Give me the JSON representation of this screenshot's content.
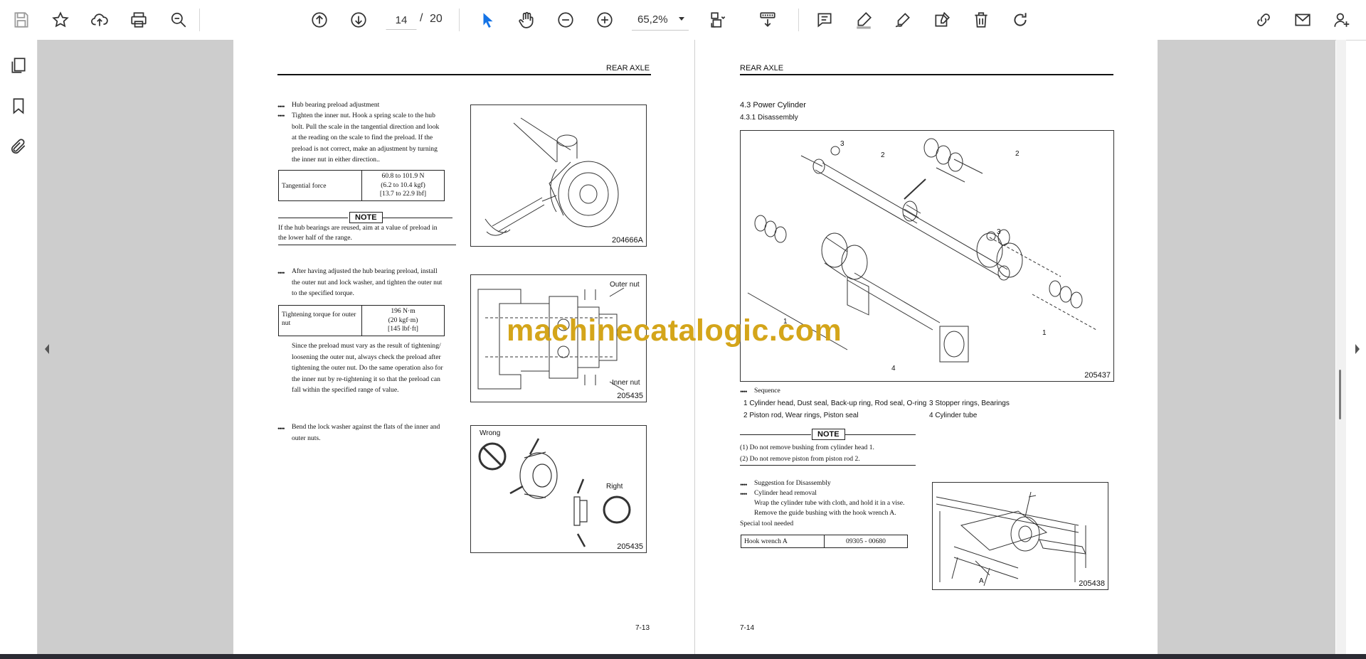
{
  "toolbar": {
    "page_current": "14",
    "page_separator": "/",
    "page_total": "20",
    "zoom_value": "65,2%"
  },
  "left_page": {
    "header": "REAR AXLE",
    "bullet_marker": "••••",
    "step1_title": "Hub bearing preload adjustment",
    "step1_lines": [
      "Tighten the inner nut. Hook a spring scale to the hub",
      "bolt. Pull the scale in the tangential direction and look",
      "at the reading on the scale to find the preload. If the",
      "preload is not correct, make an adjustment by turning",
      "the inner nut in either direction.."
    ],
    "spec1_label": "Tangential force",
    "spec1_values": [
      "60.8 to 101.9 N",
      "(6.2 to 10.4 kgf)",
      "[13.7 to 22.9 lbf]"
    ],
    "note_label": "NOTE",
    "note_lines": [
      "If the hub bearings are reused, aim at a value of preload in",
      "the lower half of the range."
    ],
    "step2_lines": [
      "After having adjusted the hub bearing preload, install",
      "the outer nut and lock washer, and tighten the outer nut",
      "to the specified torque."
    ],
    "spec2_label_lines": [
      "Tightening torque for outer",
      "nut"
    ],
    "spec2_values": [
      "196 N·m",
      "(20 kgf·m)",
      "[145 lbf·ft]"
    ],
    "para_lines": [
      "Since the preload must vary as the result of tightening/",
      "loosening the outer nut, always check the preload after",
      "tightening the outer nut. Do the same operation also for",
      "the inner nut by re-tightening it so that the preload can",
      "fall within the specified range of value."
    ],
    "step3_lines": [
      "Bend the lock washer against the flats of the inner and",
      "outer nuts."
    ],
    "fig1_id": "204666A",
    "fig2_id": "205435",
    "fig2_outer": "Outer nut",
    "fig2_inner": "Inner nut",
    "fig3_id": "205435",
    "fig3_wrong": "Wrong",
    "fig3_right": "Right",
    "page_number": "7-13"
  },
  "right_page": {
    "header": "REAR AXLE",
    "section": "4.3    Power Cylinder",
    "subsection": "4.3.1    Disassembly",
    "fig_id": "205437",
    "fig_callouts": [
      "1",
      "1",
      "2",
      "2",
      "3",
      "3",
      "4"
    ],
    "sequence_title": "Sequence",
    "sequence_items": [
      "1   Cylinder head, Dust seal, Back-up ring, Rod seal, O-ring",
      "2   Piston rod, Wear rings, Piston seal",
      "3   Stopper rings, Bearings",
      "4   Cylinder tube"
    ],
    "note_label": "NOTE",
    "note_items": [
      "(1)    Do not remove bushing from cylinder head 1.",
      "(2)    Do not remove piston from piston rod 2."
    ],
    "suggestion_title": "Suggestion for Disassembly",
    "head_removal_title": "Cylinder head removal",
    "head_removal_lines": [
      "Wrap the cylinder tube with cloth, and hold it in a vise.",
      "Remove the guide bushing with the hook wrench A."
    ],
    "special_tool_label": "Special tool needed",
    "tool_name": "Hook wrench A",
    "tool_number": "09305 - 00680",
    "fig2_id": "205438",
    "fig2_callout": "A",
    "page_number": "7-14"
  },
  "watermark": "machinecatalogic.com"
}
